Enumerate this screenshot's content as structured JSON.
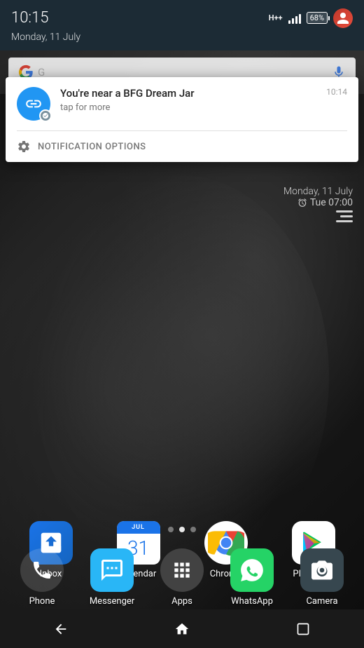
{
  "statusBar": {
    "time": "10:15",
    "date": "Monday, 11 July",
    "battery": "68%",
    "signal": "H++"
  },
  "notification": {
    "title": "You're near a BFG Dream Jar",
    "subtitle": "tap for more",
    "time": "10:14",
    "options_label": "NOTIFICATION OPTIONS"
  },
  "dateOverlay": {
    "date": "Monday, 11 July",
    "alarm": "Tue 07:00"
  },
  "apps": {
    "row1": [
      {
        "label": "Inbox",
        "id": "inbox"
      },
      {
        "label": "Calendar",
        "id": "calendar",
        "date": "31"
      },
      {
        "label": "Chrome",
        "id": "chrome"
      },
      {
        "label": "Play Store",
        "id": "play-store"
      }
    ],
    "row2": [
      {
        "label": "Phone",
        "id": "phone"
      },
      {
        "label": "Messenger",
        "id": "messenger"
      },
      {
        "label": "Apps",
        "id": "apps"
      },
      {
        "label": "WhatsApp",
        "id": "whatsapp"
      },
      {
        "label": "Camera",
        "id": "camera"
      }
    ]
  },
  "navBar": {
    "back_label": "◁",
    "home_label": "⌂",
    "recent_label": "▢"
  }
}
